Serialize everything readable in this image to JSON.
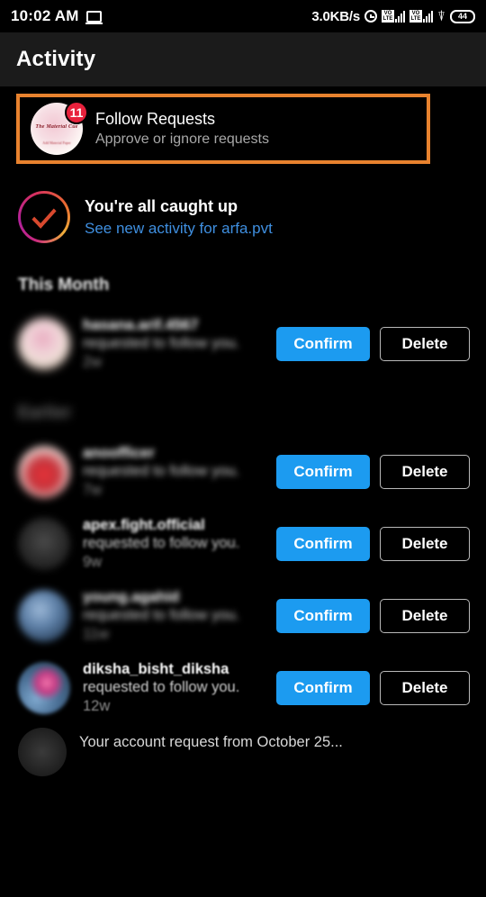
{
  "statusbar": {
    "time": "10:02 AM",
    "cast_icon": "monitor-icon",
    "network_speed": "3.0KB/s",
    "alarm_icon": "alarm-clock-icon",
    "sim1_label_top": "VO",
    "sim1_label_bottom": "LTE",
    "sim2_label_top": "VO",
    "sim2_label_bottom": "LTE",
    "wifi_icon": "wifi-icon",
    "battery_level": "44"
  },
  "appbar": {
    "title": "Activity"
  },
  "follow_requests": {
    "title": "Follow Requests",
    "subtitle": "Approve or ignore requests",
    "badge_count": "11",
    "avatar_logo_top": "The Material Cue",
    "avatar_logo_bottom": "Add Material Paper",
    "highlight_color": "#e8822e"
  },
  "caught_up": {
    "title": "You're all caught up",
    "link": "See new activity for arfa.pvt",
    "link_color": "#3f8fe0",
    "check_icon": "check-circle-icon"
  },
  "sections": [
    {
      "label": "This Month"
    },
    {
      "label": "Earlier"
    }
  ],
  "buttons": {
    "confirm": "Confirm",
    "delete": "Delete",
    "confirm_color": "#1c9bf0"
  },
  "requests": [
    {
      "name": "hasana.arif.4567",
      "action": "requested to follow you.",
      "age": "2w",
      "section": "This Month"
    },
    {
      "name": "anoofficer",
      "action": "requested to follow you.",
      "age": "7w",
      "section": "Earlier"
    },
    {
      "name": "apex.fight.official",
      "action": "requested to follow you.",
      "age": "9w",
      "section": "Earlier"
    },
    {
      "name": "young.agahid",
      "action": "requested to follow you.",
      "age": "11w",
      "section": "Earlier"
    },
    {
      "name": "diksha_bisht_diksha",
      "action": "requested to follow you.",
      "age": "12w",
      "section": "Earlier"
    }
  ],
  "partial_row": {
    "text": "Your account request from October 25..."
  }
}
